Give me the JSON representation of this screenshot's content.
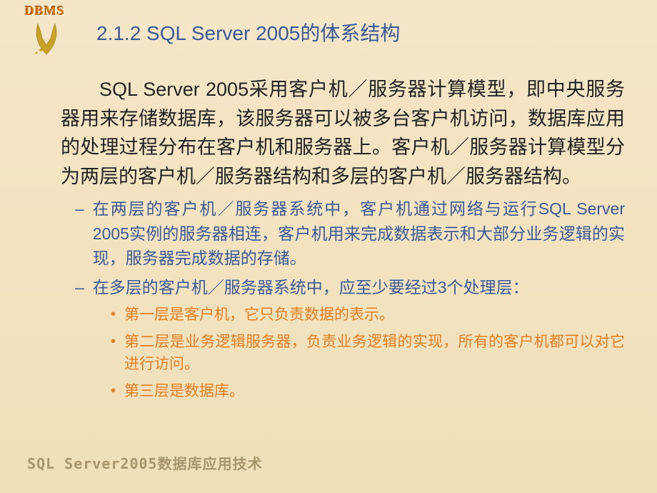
{
  "logo": {
    "text": "DBMS"
  },
  "title": "2.1.2  SQL Server 2005的体系结构",
  "intro": "SQL Server 2005采用客户机／服务器计算模型，即中央服务器用来存储数据库，该服务器可以被多台客户机访问，数据库应用的处理过程分布在客户机和服务器上。客户机／服务器计算模型分为两层的客户机／服务器结构和多层的客户机／服务器结构。",
  "subItems": [
    "在两层的客户机／服务器系统中，客户机通过网络与运行SQL Server 2005实例的服务器相连，客户机用来完成数据表示和大部分业务逻辑的实现，服务器完成数据的存储。",
    "在多层的客户机／服务器系统中，应至少要经过3个处理层："
  ],
  "bulletItems": [
    "第一层是客户机，它只负责数据的表示。",
    "第二层是业务逻辑服务器，负责业务逻辑的实现，所有的客户机都可以对它进行访问。",
    "第三层是数据库。"
  ],
  "footer": "SQL Server2005数据库应用技术"
}
